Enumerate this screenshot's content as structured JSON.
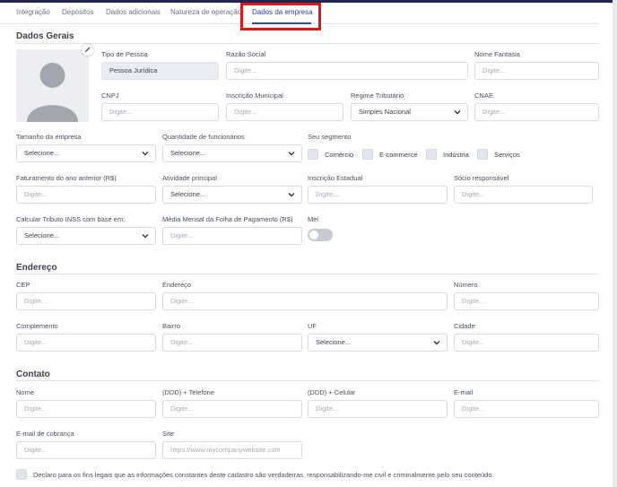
{
  "tabs": [
    {
      "label": "Integração"
    },
    {
      "label": "Depósitos"
    },
    {
      "label": "Dados adicionais"
    },
    {
      "label": "Natureza de operação"
    },
    {
      "label": "Dados da empresa"
    }
  ],
  "active_tab": "Dados da empresa",
  "colors": {
    "accent": "#3246a8",
    "highlight": "#e01515",
    "topbar": "#1f2550"
  },
  "general": {
    "title": "Dados Gerais",
    "tipo_pessoa": {
      "label": "Tipo de Pessoa",
      "value": "Pessoa Jurídica"
    },
    "razao_social": {
      "label": "Razão Social",
      "placeholder": "Digite..."
    },
    "nome_fantasia": {
      "label": "Nome Fantasia",
      "placeholder": "Digite..."
    },
    "cnpj": {
      "label": "CNPJ",
      "placeholder": "Digite..."
    },
    "inscricao_municipal": {
      "label": "Inscrição Municipal",
      "placeholder": "Digite..."
    },
    "regime_tributario": {
      "label": "Regime Tributário",
      "value": "Simples Nacional"
    },
    "cnae": {
      "label": "CNAE",
      "placeholder": "Digite..."
    },
    "tamanho": {
      "label": "Tamanho da empresa",
      "value": "Selecione..."
    },
    "quantidade": {
      "label": "Quantidade de funcionários",
      "value": "Selecione..."
    },
    "segmento": {
      "label": "Seu segmento",
      "options": [
        {
          "label": "Comércio",
          "checked": false
        },
        {
          "label": "E-commerce",
          "checked": false
        },
        {
          "label": "Indústria",
          "checked": false
        },
        {
          "label": "Serviços",
          "checked": false
        }
      ]
    },
    "faturamento": {
      "label": "Faturamento do ano anterior (R$)",
      "placeholder": "Digite..."
    },
    "atividade": {
      "label": "Atividade principal",
      "value": "Selecione..."
    },
    "inscricao_estadual": {
      "label": "Inscrição Estadual",
      "placeholder": "Digite..."
    },
    "socio": {
      "label": "Sócio responsável",
      "placeholder": "Digite..."
    },
    "inss": {
      "label": "Calcular Tributo INSS com base em:",
      "value": "Selecione..."
    },
    "media_folha": {
      "label": "Média Mensal da Folha de Pagamento (R$)",
      "placeholder": "Digite..."
    },
    "mei": {
      "label": "Mei",
      "enabled": false
    }
  },
  "address": {
    "title": "Endereço",
    "cep": {
      "label": "CEP",
      "placeholder": "Digite..."
    },
    "endereco": {
      "label": "Endereço",
      "placeholder": "Digite..."
    },
    "numero": {
      "label": "Número",
      "placeholder": "Digite..."
    },
    "complemento": {
      "label": "Complemento",
      "placeholder": "Digite..."
    },
    "bairro": {
      "label": "Bairro",
      "placeholder": "Digite..."
    },
    "uf": {
      "label": "UF",
      "value": "Selecione..."
    },
    "cidade": {
      "label": "Cidade",
      "placeholder": "Digite..."
    }
  },
  "contact": {
    "title": "Contato",
    "nome": {
      "label": "Nome",
      "placeholder": "Digite..."
    },
    "telefone": {
      "label": "(DDD) + Telefone",
      "placeholder": "Digite..."
    },
    "celular": {
      "label": "(DDD) + Celular",
      "placeholder": "Digite..."
    },
    "email": {
      "label": "E-mail",
      "placeholder": "Digite..."
    },
    "email_cobranca": {
      "label": "E-mail de cobrança",
      "placeholder": "Digite..."
    },
    "site": {
      "label": "Site",
      "placeholder": "https://www.mycompanywebsite.com"
    }
  },
  "declaration": "Declaro para os fins legais que as informações constantes deste cadastro são verdadeiras, responsabilizando-me civil e criminalmente pelo seu conteúdo."
}
